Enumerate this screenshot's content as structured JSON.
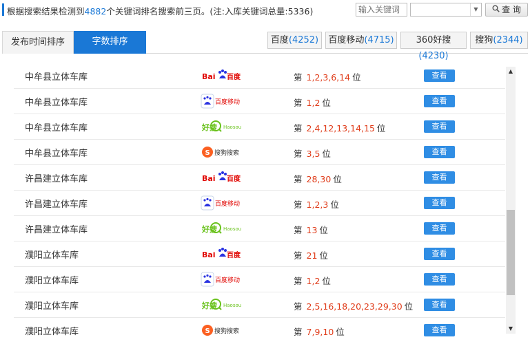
{
  "summary": {
    "prefix": "根据搜索结果检测到",
    "count": "4882",
    "suffix": "个关键词排名搜索前三页。(注:入库关键词总量:5336)"
  },
  "search": {
    "placeholder": "输入关键词",
    "button_label": "查 询"
  },
  "tabs": [
    {
      "label": "发布时间排序"
    },
    {
      "label": "字数排序"
    }
  ],
  "engines": [
    {
      "name": "百度",
      "count": "(4252)"
    },
    {
      "name": "百度移动",
      "count": "(4715)"
    },
    {
      "name": "360好搜",
      "count": "(4230)"
    },
    {
      "name": "搜狗",
      "count": "(2344)"
    }
  ],
  "logos": {
    "baidu": {
      "text": "百度",
      "prefix": "Bai"
    },
    "baidu_mobile": {
      "text": "百度移动"
    },
    "haosou": {
      "text": "好搜",
      "latin": "Haosou"
    },
    "sogou": {
      "text": "搜狗搜索"
    }
  },
  "rows": [
    {
      "keyword": "中牟县立体车库",
      "engine": "baidu",
      "prefix": "第",
      "positions": "1,2,3,6,14",
      "unit": "位",
      "action": "查看"
    },
    {
      "keyword": "中牟县立体车库",
      "engine": "baidu_mobile",
      "prefix": "第",
      "positions": "1,2",
      "unit": "位",
      "action": "查看"
    },
    {
      "keyword": "中牟县立体车库",
      "engine": "haosou",
      "prefix": "第",
      "positions": "2,4,12,13,14,15",
      "unit": "位",
      "action": "查看"
    },
    {
      "keyword": "中牟县立体车库",
      "engine": "sogou",
      "prefix": "第",
      "positions": "3,5",
      "unit": "位",
      "action": "查看"
    },
    {
      "keyword": "许昌建立体车库",
      "engine": "baidu",
      "prefix": "第",
      "positions": "28,30",
      "unit": "位",
      "action": "查看"
    },
    {
      "keyword": "许昌建立体车库",
      "engine": "baidu_mobile",
      "prefix": "第",
      "positions": "1,2,3",
      "unit": "位",
      "action": "查看"
    },
    {
      "keyword": "许昌建立体车库",
      "engine": "haosou",
      "prefix": "第",
      "positions": "13",
      "unit": "位",
      "action": "查看"
    },
    {
      "keyword": "濮阳立体车库",
      "engine": "baidu",
      "prefix": "第",
      "positions": "21",
      "unit": "位",
      "action": "查看"
    },
    {
      "keyword": "濮阳立体车库",
      "engine": "baidu_mobile",
      "prefix": "第",
      "positions": "1,2",
      "unit": "位",
      "action": "查看"
    },
    {
      "keyword": "濮阳立体车库",
      "engine": "haosou",
      "prefix": "第",
      "positions": "2,5,16,18,20,23,29,30",
      "unit": "位",
      "action": "查看"
    },
    {
      "keyword": "濮阳立体车库",
      "engine": "sogou",
      "prefix": "第",
      "positions": "7,9,10",
      "unit": "位",
      "action": "查看"
    }
  ],
  "colors": {
    "accent": "#1a78d6",
    "rank": "#e03c1a",
    "view_button": "#2f8de4"
  }
}
